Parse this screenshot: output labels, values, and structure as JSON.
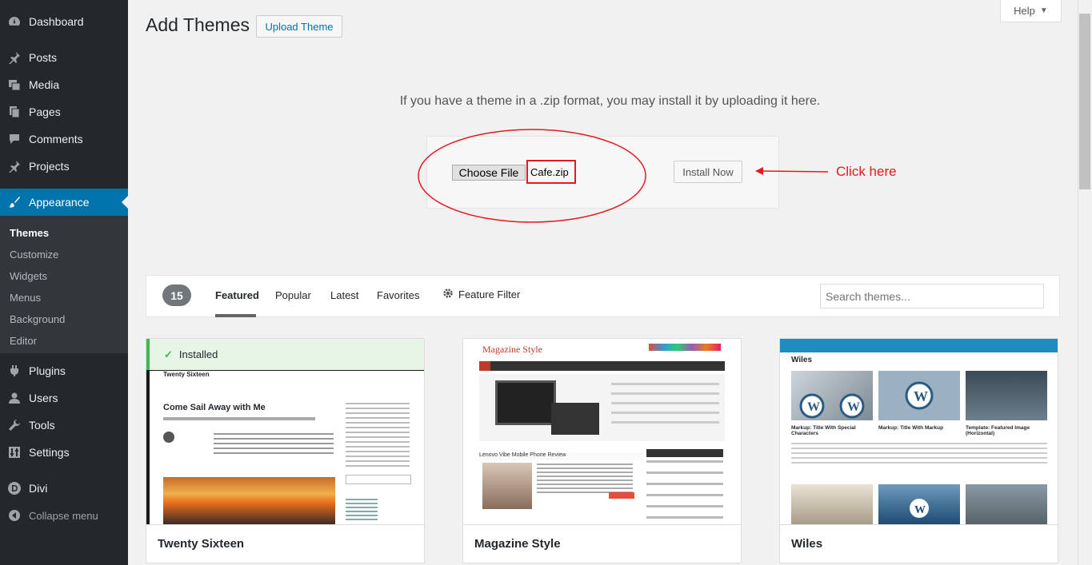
{
  "sidebar": {
    "items": [
      {
        "label": "Dashboard",
        "icon": "dashboard-icon"
      },
      {
        "label": "Posts",
        "icon": "pin-icon"
      },
      {
        "label": "Media",
        "icon": "media-icon"
      },
      {
        "label": "Pages",
        "icon": "pages-icon"
      },
      {
        "label": "Comments",
        "icon": "comments-icon"
      },
      {
        "label": "Projects",
        "icon": "pin-icon"
      },
      {
        "label": "Appearance",
        "icon": "brush-icon"
      },
      {
        "label": "Plugins",
        "icon": "plugin-icon"
      },
      {
        "label": "Users",
        "icon": "users-icon"
      },
      {
        "label": "Tools",
        "icon": "wrench-icon"
      },
      {
        "label": "Settings",
        "icon": "settings-icon"
      },
      {
        "label": "Divi",
        "icon": "divi-icon"
      },
      {
        "label": "Collapse menu",
        "icon": "collapse-icon"
      }
    ],
    "submenu": [
      "Themes",
      "Customize",
      "Widgets",
      "Menus",
      "Background",
      "Editor"
    ]
  },
  "header": {
    "title": "Add Themes",
    "upload_label": "Upload Theme",
    "help_label": "Help"
  },
  "upload": {
    "message": "If you have a theme in a .zip format, you may install it by uploading it here.",
    "choose_label": "Choose File",
    "file_name": "Cafe.zip",
    "install_label": "Install Now",
    "annotation": "Click here"
  },
  "filter": {
    "count": "15",
    "tabs": [
      "Featured",
      "Popular",
      "Latest",
      "Favorites"
    ],
    "feature_filter": "Feature Filter",
    "search_placeholder": "Search themes..."
  },
  "themes": [
    {
      "name": "Twenty Sixteen",
      "installed_label": "Installed",
      "headline": "Come Sail Away with Me",
      "site_title": "Twenty Sixteen"
    },
    {
      "name": "Magazine Style",
      "logo": "Magazine Style",
      "review_title": "Lenovo Vibe Mobile Phone Review"
    },
    {
      "name": "Wiles",
      "header": "Wiles",
      "posts": [
        "Markup: Title With Special Characters",
        "Markup: Title With Markup",
        "Template: Featured Image (Horizontal)"
      ]
    }
  ],
  "colors": {
    "accent": "#0073aa",
    "annotation": "#e21b22",
    "installed": "#46b450"
  }
}
